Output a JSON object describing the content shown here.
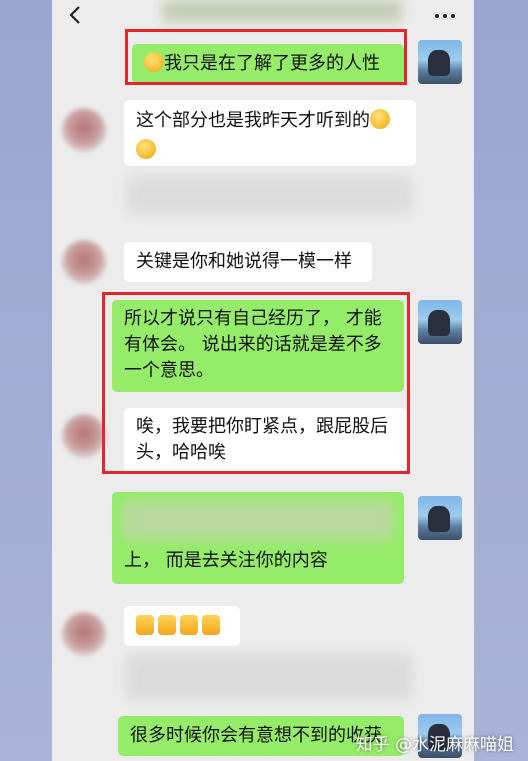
{
  "messages": {
    "m1": "我只是在了解了更多的人性",
    "m2_line1": "这个部分也是我昨天才听到的",
    "m3": "关键是你和她说得一模一样",
    "m4_line1": "所以才说只有自己经历了， 才能",
    "m4_line2": "有体会。 说出来的话就是差不多",
    "m4_line3": "一个意思。",
    "m5_line1": "唉，我要把你盯紧点，跟屁股后",
    "m5_line2": "头，哈哈唉",
    "m6": "上， 而是去关注你的内容",
    "m8": "很多时候你会有意想不到的收获"
  },
  "watermark": "知乎 @水泥麻麻喵姐",
  "icons": {
    "back": "chevron-left-icon",
    "more": "more-dots-icon",
    "think_emoji": "thinking-face-emoji",
    "sweat_emoji": "sweat-smile-emoji",
    "thumb_emoji": "thumbs-up-emoji"
  },
  "colors": {
    "highlight": "#e0272c",
    "bubble_self": "#95ec69",
    "bubble_other": "#ffffff",
    "chat_bg": "#ececec"
  }
}
